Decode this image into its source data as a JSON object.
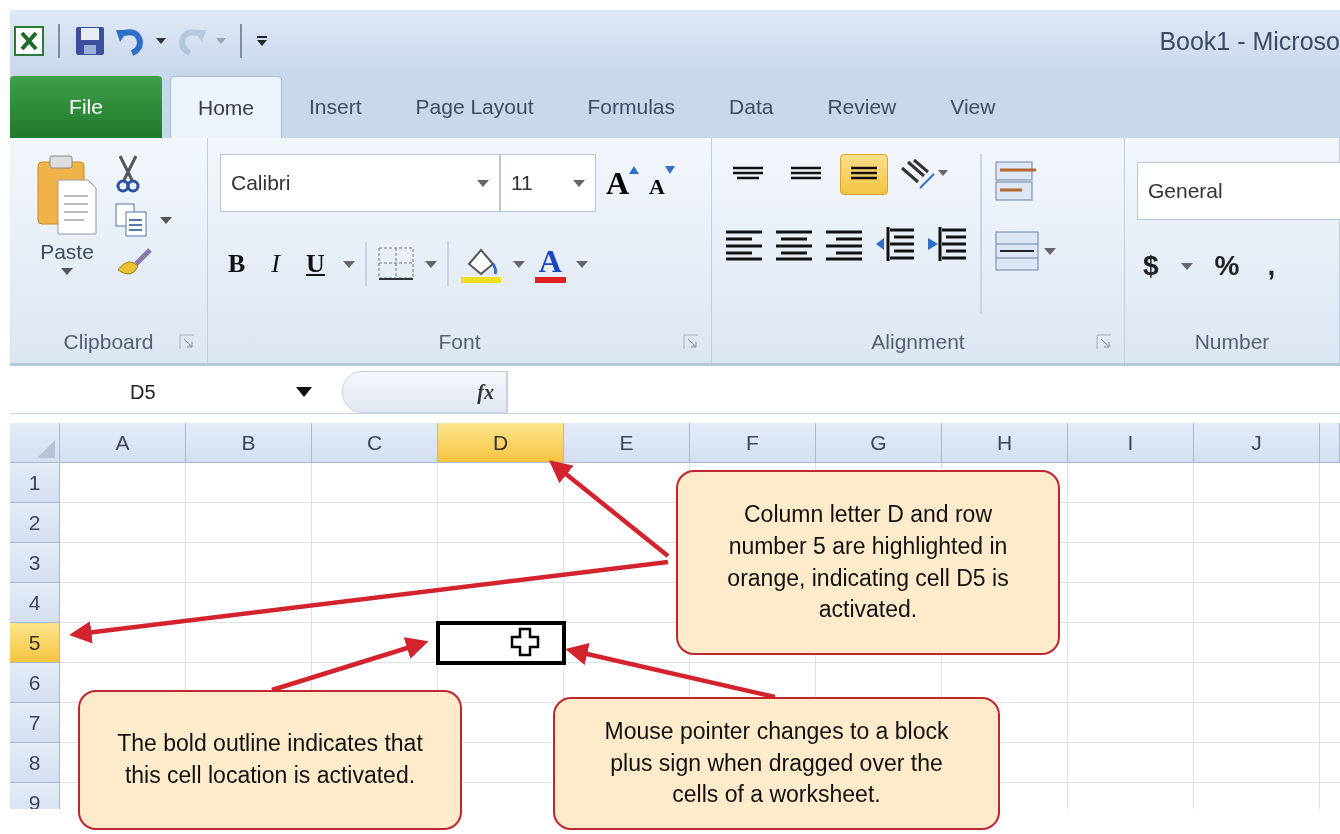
{
  "window": {
    "title": "Book1 - Microso"
  },
  "quick_access": [
    {
      "kind": "save",
      "disabled": false
    },
    {
      "kind": "undo",
      "disabled": false
    },
    {
      "kind": "redo",
      "disabled": true
    }
  ],
  "tabs": [
    {
      "label": "File",
      "kind": "file",
      "selected": false
    },
    {
      "label": "Home",
      "kind": "tab",
      "selected": true
    },
    {
      "label": "Insert",
      "kind": "tab",
      "selected": false
    },
    {
      "label": "Page Layout",
      "kind": "tab",
      "selected": false
    },
    {
      "label": "Formulas",
      "kind": "tab",
      "selected": false
    },
    {
      "label": "Data",
      "kind": "tab",
      "selected": false
    },
    {
      "label": "Review",
      "kind": "tab",
      "selected": false
    },
    {
      "label": "View",
      "kind": "tab",
      "selected": false
    }
  ],
  "ribbon": {
    "groups": [
      {
        "label": "Clipboard",
        "launcher": true
      },
      {
        "label": "Font",
        "launcher": true
      },
      {
        "label": "Alignment",
        "launcher": true
      },
      {
        "label": "Number",
        "launcher": false
      }
    ],
    "paste_label": "Paste",
    "font_name": "Calibri",
    "font_size": "11",
    "grow_font": "A",
    "shrink_font": "A",
    "font_styles": [
      {
        "kind": "bold",
        "label": "B"
      },
      {
        "kind": "italic",
        "label": "I"
      },
      {
        "kind": "underline",
        "label": "U"
      }
    ],
    "font_color_label": "A",
    "vertical_align": [
      {
        "kind": "top",
        "selected": false
      },
      {
        "kind": "middle",
        "selected": false
      },
      {
        "kind": "bottom",
        "selected": true
      }
    ],
    "number_format": "General",
    "currency": "$",
    "percent": "%",
    "comma": ","
  },
  "formula_bar": {
    "name_box": "D5",
    "function_label": "fx"
  },
  "grid": {
    "columns": [
      {
        "label": "A",
        "selected": false
      },
      {
        "label": "B",
        "selected": false
      },
      {
        "label": "C",
        "selected": false
      },
      {
        "label": "D",
        "selected": true
      },
      {
        "label": "E",
        "selected": false
      },
      {
        "label": "F",
        "selected": false
      },
      {
        "label": "G",
        "selected": false
      },
      {
        "label": "H",
        "selected": false
      },
      {
        "label": "I",
        "selected": false
      },
      {
        "label": "J",
        "selected": false
      }
    ],
    "rows": [
      {
        "label": "1",
        "selected": false
      },
      {
        "label": "2",
        "selected": false
      },
      {
        "label": "3",
        "selected": false
      },
      {
        "label": "4",
        "selected": false
      },
      {
        "label": "5",
        "selected": true
      },
      {
        "label": "6",
        "selected": false
      },
      {
        "label": "7",
        "selected": false
      },
      {
        "label": "8",
        "selected": false
      },
      {
        "label": "9",
        "selected": false
      }
    ]
  },
  "callouts": [
    {
      "text": "Column letter D and row number 5 are highlighted in orange, indicating cell D5 is activated."
    },
    {
      "text": "The bold outline indicates that this cell location is activated."
    },
    {
      "text": "Mouse pointer changes to a block plus sign when dragged over the cells of a worksheet."
    }
  ]
}
